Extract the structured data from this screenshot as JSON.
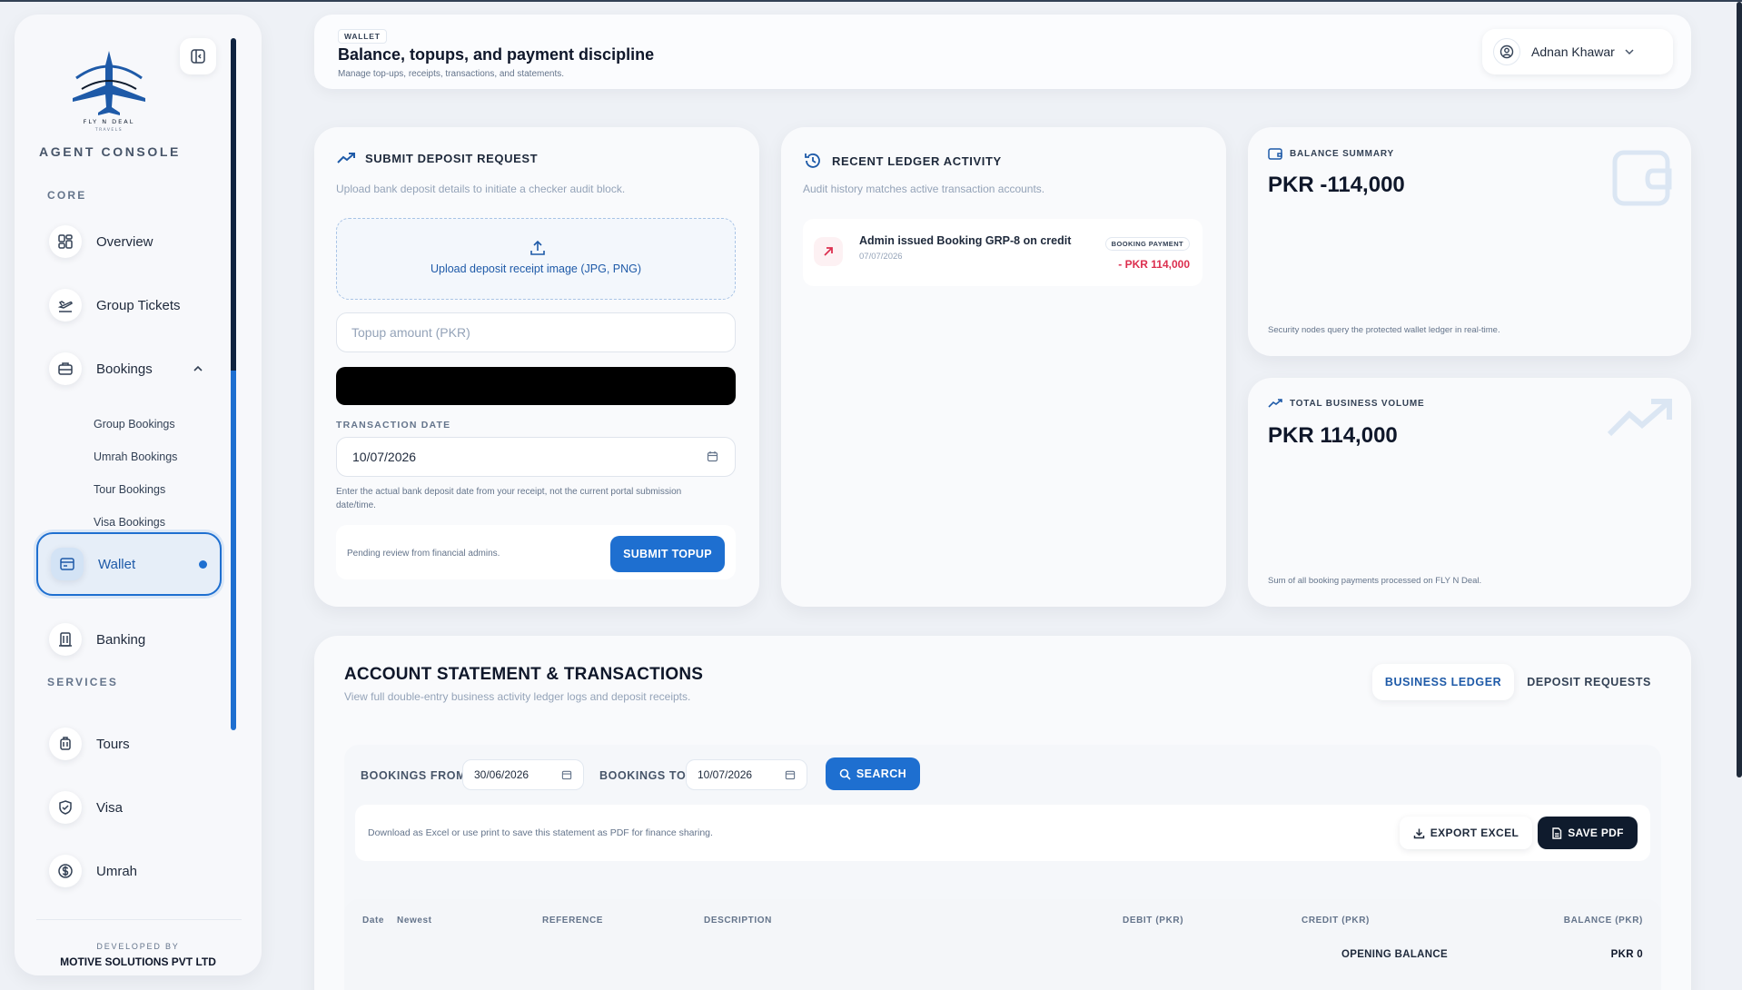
{
  "sidebar": {
    "brand": "FLY N DEAL",
    "brand_tag": "TRAVELS",
    "console_title": "AGENT CONSOLE",
    "sections": {
      "core": "CORE",
      "services": "SERVICES"
    },
    "items": [
      {
        "label": "Overview",
        "icon": "grid-icon"
      },
      {
        "label": "Group Tickets",
        "icon": "plane-takeoff-icon"
      },
      {
        "label": "Bookings",
        "icon": "briefcase-icon"
      },
      {
        "label": "Wallet",
        "icon": "wallet-icon"
      },
      {
        "label": "Banking",
        "icon": "bank-building-icon"
      },
      {
        "label": "Tours",
        "icon": "luggage-icon"
      },
      {
        "label": "Visa",
        "icon": "shield-check-icon"
      },
      {
        "label": "Umrah",
        "icon": "dollar-circle-icon"
      }
    ],
    "booking_subitems": [
      "Group Bookings",
      "Umrah Bookings",
      "Tour Bookings",
      "Visa Bookings"
    ],
    "developed_by": "DEVELOPED BY",
    "company": "MOTIVE SOLUTIONS PVT LTD"
  },
  "header": {
    "badge": "WALLET",
    "title": "Balance, topups, and payment discipline",
    "subtitle": "Manage top-ups, receipts, transactions, and statements.",
    "user_name": "Adnan Khawar"
  },
  "deposit": {
    "title": "SUBMIT DEPOSIT REQUEST",
    "description": "Upload bank deposit details to initiate a checker audit block.",
    "upload_label": "Upload deposit receipt image (JPG, PNG)",
    "amount_placeholder": "Topup amount (PKR)",
    "date_label": "TRANSACTION DATE",
    "date_value": "10/07/2026",
    "hint": "Enter the actual bank deposit date from your receipt, not the current portal submission date/time.",
    "pending_text": "Pending review from financial admins.",
    "submit_label": "SUBMIT TOPUP"
  },
  "ledger": {
    "title": "RECENT LEDGER ACTIVITY",
    "description": "Audit history matches active transaction accounts.",
    "items": [
      {
        "title": "Admin issued Booking GRP-8 on credit",
        "date": "07/07/2026",
        "badge": "BOOKING PAYMENT",
        "amount": "- PKR 114,000"
      }
    ]
  },
  "balance_summary": {
    "title": "BALANCE SUMMARY",
    "value": "PKR -114,000",
    "footnote": "Security nodes query the protected wallet ledger in real-time."
  },
  "business_volume": {
    "title": "TOTAL BUSINESS VOLUME",
    "value": "PKR 114,000",
    "footnote": "Sum of all booking payments processed on FLY N Deal."
  },
  "statement": {
    "title": "ACCOUNT STATEMENT & TRANSACTIONS",
    "subtitle": "View full double-entry business activity ledger logs and deposit receipts.",
    "tabs": [
      "BUSINESS LEDGER",
      "DEPOSIT REQUESTS"
    ],
    "from_label": "BOOKINGS FROM",
    "from_value": "30/06/2026",
    "to_label": "BOOKINGS TO",
    "to_value": "10/07/2026",
    "search_label": "SEARCH",
    "export_text": "Download as Excel or use print to save this statement as PDF for finance sharing.",
    "excel_label": "EXPORT EXCEL",
    "pdf_label": "SAVE PDF",
    "columns": [
      "Date",
      "Newest",
      "REFERENCE",
      "DESCRIPTION",
      "DEBIT (PKR)",
      "CREDIT (PKR)",
      "BALANCE (PKR)"
    ],
    "opening_label": "OPENING BALANCE",
    "opening_value": "PKR 0"
  },
  "colors": {
    "accent": "#1e6fd0",
    "dark": "#0f1b2d",
    "debit": "#dc2f4f"
  }
}
